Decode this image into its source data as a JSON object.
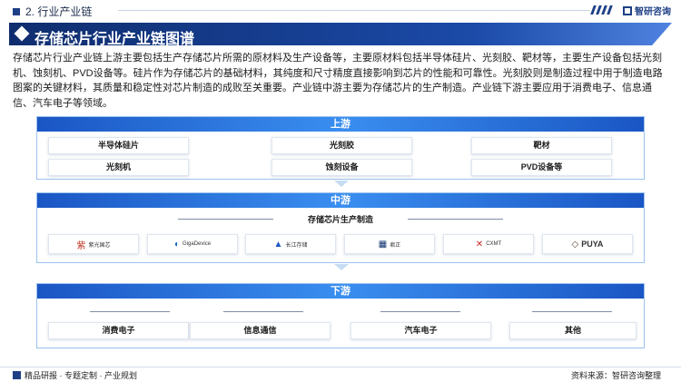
{
  "header": {
    "section": "2. 行业产业链",
    "brand": "智研咨询"
  },
  "title": "存储芯片行业产业链图谱",
  "intro": "存储芯片行业产业链上游主要包括生产存储芯片所需的原材料及生产设备等，主要原材料包括半导体硅片、光刻胶、靶材等，主要生产设备包括光刻机、蚀刻机、PVD设备等。硅片作为存储芯片的基础材料，其纯度和尺寸精度直接影响到芯片的性能和可靠性。光刻胶则是制造过程中用于制造电路图案的关键材料，其质量和稳定性对芯片制造的成败至关重要。产业链中游主要为存储芯片的生产制造。产业链下游主要应用于消费电子、信息通信、汽车电子等领域。",
  "upstream": {
    "label": "上游",
    "items": [
      "半导体硅片",
      "光刻胶",
      "靶材",
      "光刻机",
      "蚀刻设备",
      "PVD设备等"
    ]
  },
  "midstream": {
    "label": "中游",
    "subtitle": "存储芯片生产制造",
    "companies": [
      {
        "mark": "紫",
        "name": "紫光国芯",
        "color": "#c0392b"
      },
      {
        "mark": "◐",
        "name": "GigaDevice",
        "color": "#1565c0"
      },
      {
        "mark": "▲",
        "name": "长江存储",
        "color": "#1a56c4"
      },
      {
        "mark": "▦",
        "name": "君正",
        "color": "#0d2f6e"
      },
      {
        "mark": "✕",
        "name": "CXMT",
        "color": "#c62828"
      },
      {
        "mark": "◇",
        "name": "PUYA",
        "color": "#5d4037"
      }
    ]
  },
  "downstream": {
    "label": "下游",
    "items": [
      "消费电子",
      "信息通信",
      "汽车电子",
      "其他"
    ]
  },
  "footer": {
    "left": "精品研报 · 专题定制 · 产业规划",
    "right": "资料来源：智研咨询整理"
  }
}
